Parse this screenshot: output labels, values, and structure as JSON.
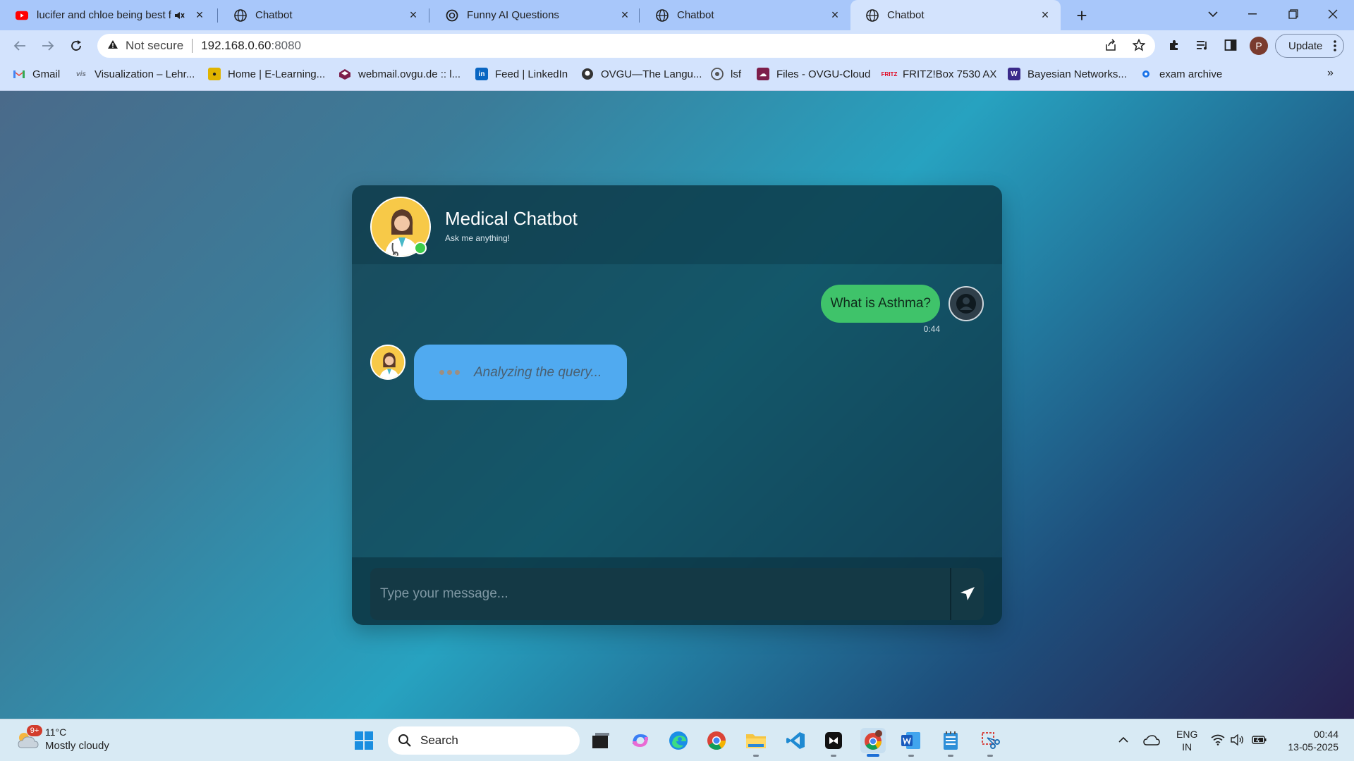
{
  "browser": {
    "tabs": [
      {
        "title": "lucifer and chloe being best f",
        "favicon": "youtube-icon",
        "muted": true
      },
      {
        "title": "Chatbot",
        "favicon": "globe-icon"
      },
      {
        "title": "Funny AI Questions",
        "favicon": "openai-icon"
      },
      {
        "title": "Chatbot",
        "favicon": "globe-icon"
      },
      {
        "title": "Chatbot",
        "favicon": "globe-icon",
        "active": true
      }
    ],
    "address": {
      "security_label": "Not secure",
      "host": "192.168.0.60",
      "port": ":8080"
    },
    "update_label": "Update",
    "profile_initial": "P",
    "bookmarks": [
      {
        "label": "Gmail",
        "icon": "gmail-icon",
        "color": "#ea4335"
      },
      {
        "label": "Visualization – Lehr...",
        "icon": "vis-icon",
        "color": "#6b7380"
      },
      {
        "label": "Home | E-Learning...",
        "icon": "elearning-icon",
        "color": "#e0b400"
      },
      {
        "label": "webmail.ovgu.de :: l...",
        "icon": "webmail-icon",
        "color": "#7d1e4a"
      },
      {
        "label": "Feed | LinkedIn",
        "icon": "linkedin-icon",
        "color": "#0a66c2"
      },
      {
        "label": "OVGU—The Langu...",
        "icon": "ovgu-icon",
        "color": "#333333"
      },
      {
        "label": "lsf",
        "icon": "lsf-icon",
        "color": "#555555"
      },
      {
        "label": "Files - OVGU-Cloud",
        "icon": "cloud-icon",
        "color": "#7d1e4a"
      },
      {
        "label": "FRITZ!Box 7530 AX",
        "icon": "fritz-icon",
        "color": "#e2001a"
      },
      {
        "label": "Bayesian Networks...",
        "icon": "bayes-icon",
        "color": "#3a2a8a"
      },
      {
        "label": "exam archive",
        "icon": "exam-icon",
        "color": "#1a73e8"
      }
    ]
  },
  "chat": {
    "bot_name": "Medical Chatbot",
    "bot_tagline": "Ask me anything!",
    "messages": {
      "user_text": "What is Asthma?",
      "user_time": "0:44",
      "bot_status": "Analyzing the query..."
    },
    "input_placeholder": "Type your message...",
    "colors": {
      "user_bubble": "#3fc36a",
      "bot_bubble": "#50aaf0",
      "online": "#3dcc4a"
    }
  },
  "taskbar": {
    "weather": {
      "badge": "9+",
      "temp": "11°C",
      "desc": "Mostly cloudy"
    },
    "search_label": "Search",
    "lang_top": "ENG",
    "lang_bottom": "IN",
    "time": "00:44",
    "date": "13-05-2025"
  }
}
